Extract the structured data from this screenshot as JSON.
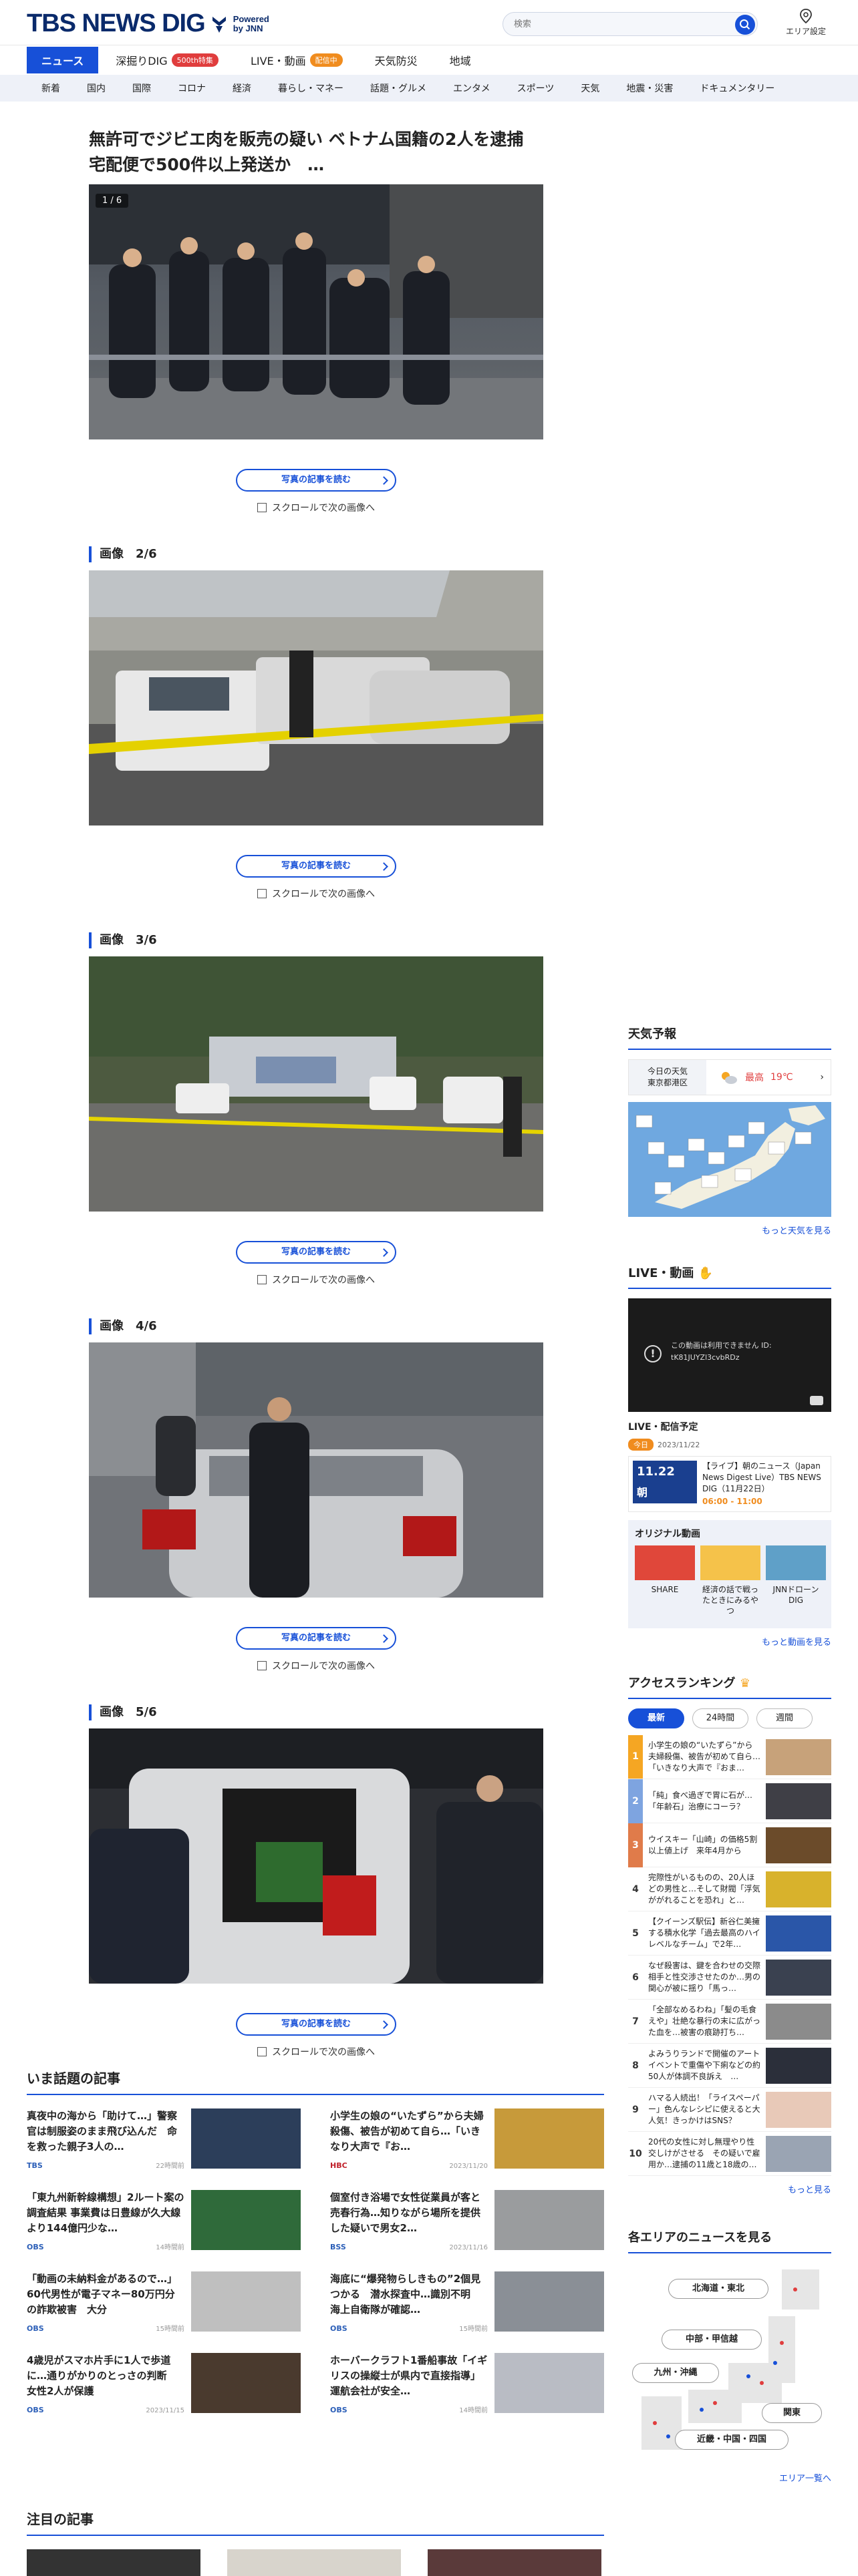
{
  "header": {
    "logo": "TBS NEWS DIG",
    "powered_line1": "Powered",
    "powered_line2": "by JNN",
    "search_placeholder": "検索",
    "area_label": "エリア設定"
  },
  "nav_main": [
    {
      "label": "ニュース",
      "active": true
    },
    {
      "label": "深掘りDIG",
      "badge": "500th特集",
      "badge_color": "red"
    },
    {
      "label": "LIVE・動画",
      "badge": "配信中",
      "badge_color": "orange"
    },
    {
      "label": "天気防災"
    },
    {
      "label": "地域"
    }
  ],
  "nav_sub": [
    "新着",
    "国内",
    "国際",
    "コロナ",
    "経済",
    "暮らし・マネー",
    "話題・グルメ",
    "エンタメ",
    "スポーツ",
    "天気",
    "地震・災害",
    "ドキュメンタリー"
  ],
  "article": {
    "headline": "無許可でジビエ肉を販売の疑い ベトナム国籍の2人を逮捕 宅配便で500件以上発送か　…",
    "counter": "1 / 6",
    "read_button": "写真の記事を読む",
    "scroll_hint": "スクロールで次の画像へ",
    "image_labels": [
      "画像　2/6",
      "画像　3/6",
      "画像　4/6",
      "画像　5/6"
    ]
  },
  "weather": {
    "title": "天気予報",
    "today": "今日の天気",
    "place": "東京都港区",
    "max_label": "最高",
    "max_temp": "19℃",
    "more": "もっと天気を見る"
  },
  "live": {
    "title": "LIVE・動画",
    "video_text": "この動画は利用できません ID: tK81JUYZl3cvbRDz",
    "schedule_title": "LIVE・配信予定",
    "today_badge": "今日",
    "date": "2023/11/22",
    "item_title": "【ライブ】朝のニュース（Japan News Digest Live）TBS NEWS DIG（11月22日）",
    "item_time": "06:00 - 11:00",
    "thumb_date": "11.22",
    "thumb_label": "朝",
    "original_title": "オリジナル動画",
    "originals": [
      {
        "label": "SHARE"
      },
      {
        "label": "経済の話で戦ったときにみるやつ"
      },
      {
        "label": "JNNドローンDIG"
      }
    ],
    "more": "もっと動画を見る"
  },
  "ranking": {
    "title": "アクセスランキング",
    "tabs": [
      "最新",
      "24時間",
      "週間"
    ],
    "items": [
      {
        "no": "1",
        "text": "小学生の娘の“いたずら”から夫婦殺傷、被告が初めて自ら…「いきなり大声で『おま…"
      },
      {
        "no": "2",
        "text": "「純」食べ過ぎで胃に石が…「年齢石」治療にコーラ？"
      },
      {
        "no": "3",
        "text": "ウイスキー「山崎」の価格5割以上値上げ　来年4月から"
      },
      {
        "no": "4",
        "text": "完際性がいるものの、20人ほどの男性と…そして財閥「浮気ががれることを恐れ」と…"
      },
      {
        "no": "5",
        "text": "【クイーンズ駅伝】新谷仁美擁する積水化学「過去最高のハイレベルなチーム」で2年…"
      },
      {
        "no": "6",
        "text": "なぜ殺害は、鍵を合わせの交際相手と性交渉させたのか…男の関心が被に揺り「馬っ…"
      },
      {
        "no": "7",
        "text": "「全部なめるわね」「髪の毛食えや」壮絶な暴行の末に広がった血を…被害の痕跡打ち…"
      },
      {
        "no": "8",
        "text": "よみうりランドで開催のアートイベントで重傷や下痢などの約50人が体調不良訴え　…"
      },
      {
        "no": "9",
        "text": "ハマる人続出！「ライスペーパー」色んなレシピに使えると大人気！きっかけはSNS？"
      },
      {
        "no": "10",
        "text": "20代の女性に対し無理やり性交しけがさせる　その疑いで雇用か…逮捕の11歳と18歳の…"
      }
    ],
    "more": "もっと見る"
  },
  "area_news": {
    "title": "各エリアのニュースを見る",
    "areas": [
      "北海道・東北",
      "中部・甲信越",
      "九州・沖縄",
      "関東",
      "近畿・中国・四国"
    ],
    "more": "エリア一覧へ"
  },
  "trending": {
    "title": "いま話題の記事",
    "cards": [
      {
        "title": "真夜中の海から「助けて…」警察官は制服姿のまま飛び込んだ　命を救った親子3人の…",
        "source": "TBS",
        "date": "22時間前"
      },
      {
        "title": "小学生の娘の“いたずら”から夫婦殺傷、被告が初めて自ら…「いきなり大声で『お…",
        "source": "HBC",
        "date": "2023/11/20"
      },
      {
        "title": "「東九州新幹線構想」2ルート案の調査結果 事業費は日豊線が久大線より144億円少な…",
        "source": "OBS",
        "date": "14時間前"
      },
      {
        "title": "個室付き浴場で女性従業員が客と売春行為…知りながら場所を提供した疑いで男女2…",
        "source": "BSS",
        "date": "2023/11/16"
      },
      {
        "title": "「動画の未納料金があるので…」60代男性が電子マネー80万円分の詐欺被害　大分",
        "source": "OBS",
        "date": "15時間前"
      },
      {
        "title": "海底に“爆発物らしきもの”2個見つかる　潜水探査中…識別不明　海上自衛隊が確認…",
        "source": "OBS",
        "date": "15時間前"
      },
      {
        "title": "4歳児がスマホ片手に1人で歩道に…通りがかりのとっさの判断　女性2人が保護",
        "source": "OBS",
        "date": "2023/11/15"
      },
      {
        "title": "ホーバークラフト1番船事故「イギリスの操縦士が県内で直接指導」運航会社が安全…",
        "source": "OBS",
        "date": "14時間前"
      }
    ]
  },
  "featured": {
    "title": "注目の記事"
  }
}
